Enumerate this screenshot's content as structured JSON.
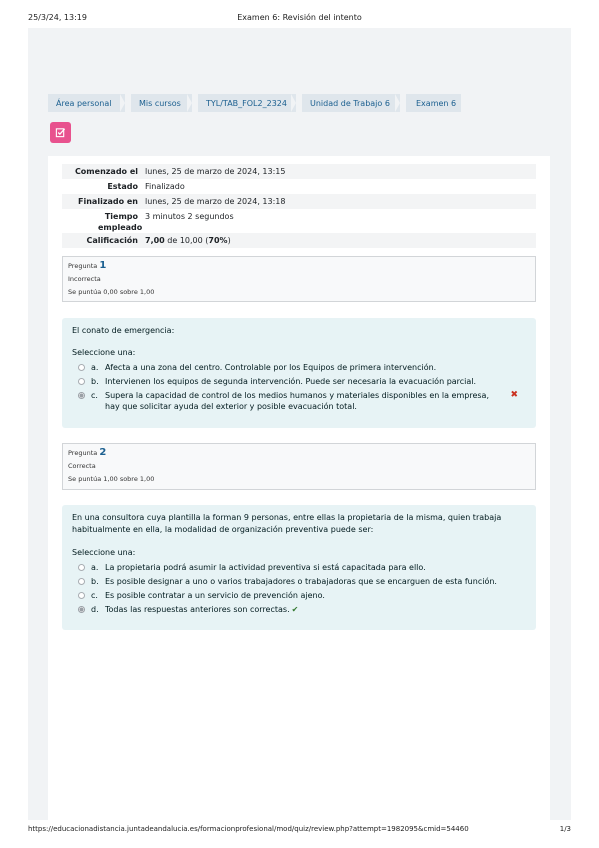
{
  "print": {
    "datetime": "25/3/24, 13:19",
    "title": "Examen 6: Revisión del intento",
    "url": "https://educacionadistancia.juntadeandalucia.es/formacionprofesional/mod/quiz/review.php?attempt=1982095&cmid=54460",
    "page": "1/3"
  },
  "breadcrumb": [
    "Área personal",
    "Mis cursos",
    "TYL/TAB_FOL2_2324",
    "Unidad de Trabajo 6",
    "Examen 6"
  ],
  "summary": {
    "started_label": "Comenzado el",
    "started_value": "lunes, 25 de marzo de 2024, 13:15",
    "state_label": "Estado",
    "state_value": "Finalizado",
    "finished_label": "Finalizado en",
    "finished_value": "lunes, 25 de marzo de 2024, 13:18",
    "time_label": "Tiempo empleado",
    "time_value": "3 minutos 2 segundos",
    "grade_label": "Calificación",
    "grade_score": "7,00",
    "grade_rest": " de 10,00 (",
    "grade_pct": "70%",
    "grade_close": ")"
  },
  "questions": [
    {
      "label": "Pregunta",
      "number": "1",
      "state": "Incorrecta",
      "grade": "Se puntúa 0,00 sobre 1,00",
      "text": "El conato de emergencia:",
      "prompt": "Seleccione una:",
      "answers": [
        {
          "letter": "a.",
          "text": "Afecta a una zona del centro. Controlable por los Equipos de primera intervención."
        },
        {
          "letter": "b.",
          "text": "Intervienen los equipos de segunda intervención. Puede ser necesaria la evacuación parcial."
        },
        {
          "letter": "c.",
          "text": "Supera la capacidad de control de los medios humanos y materiales disponibles en la empresa, hay que solicitar ayuda del exterior y posible evacuación total.",
          "mark": "✖"
        }
      ]
    },
    {
      "label": "Pregunta",
      "number": "2",
      "state": "Correcta",
      "grade": "Se puntúa 1,00 sobre 1,00",
      "text": "En una consultora cuya plantilla la forman 9 personas, entre ellas la propietaria de la misma, quien trabaja habitualmente en ella, la modalidad de organización preventiva puede ser:",
      "prompt": "Seleccione una:",
      "answers": [
        {
          "letter": "a.",
          "text": "La propietaria podrá asumir la actividad preventiva si está capacitada para ello."
        },
        {
          "letter": "b.",
          "text": "Es posible designar a uno o varios trabajadores o trabajadoras que se encarguen de esta función."
        },
        {
          "letter": "c.",
          "text": "Es posible contratar a un servicio de prevención ajeno."
        },
        {
          "letter": "d.",
          "text": "Todas las respuestas anteriores son correctas.",
          "mark": "✔"
        }
      ]
    }
  ],
  "colors": {
    "accent": "#1c6090",
    "quiz_icon": "#e8528e",
    "question_bg": "#e7f3f5",
    "incorrect": "#ca3120",
    "correct": "#357a32"
  },
  "icons": {
    "quiz": "quiz-checkbox-icon"
  }
}
